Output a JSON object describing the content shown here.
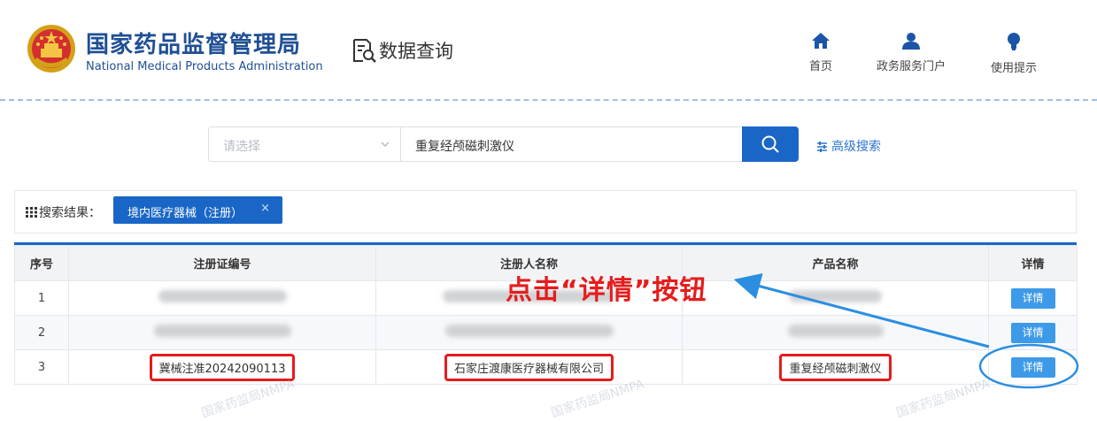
{
  "header": {
    "org_name_cn": "国家药品监督管理局",
    "org_name_en": "National Medical Products Administration",
    "section_title": "数据查询",
    "nav": [
      {
        "label": "首页",
        "icon": "home-icon"
      },
      {
        "label": "政务服务门户",
        "icon": "user-icon"
      },
      {
        "label": "使用提示",
        "icon": "lightbulb-icon"
      }
    ]
  },
  "search": {
    "category_placeholder": "请选择",
    "query_value": "重复经颅磁刺激仪",
    "advanced_label": "高级搜索"
  },
  "results": {
    "label": "搜索结果：",
    "filter_tag": "境内医疗器械（注册）",
    "filter_close": "×"
  },
  "table": {
    "headers": [
      "序号",
      "注册证编号",
      "注册人名称",
      "产品名称",
      "详情"
    ],
    "detail_label": "详情",
    "rows": [
      {
        "seq": "1",
        "cert": "",
        "registrant": "",
        "product": ""
      },
      {
        "seq": "2",
        "cert": "",
        "registrant": "",
        "product": ""
      },
      {
        "seq": "3",
        "cert": "冀械注准20242090113",
        "registrant": "石家庄渡康医疗器械有限公司",
        "product": "重复经颅磁刺激仪"
      }
    ]
  },
  "annotation": {
    "text": "点击“详情”按钮"
  },
  "watermark": "国家药监局NMPA",
  "colors": {
    "brand_blue": "#1f4f95",
    "primary": "#1a66c7",
    "detail_button": "#3d9ae8",
    "annotation_red": "#e61c1c",
    "annotation_arrow": "#2b8ee0"
  }
}
